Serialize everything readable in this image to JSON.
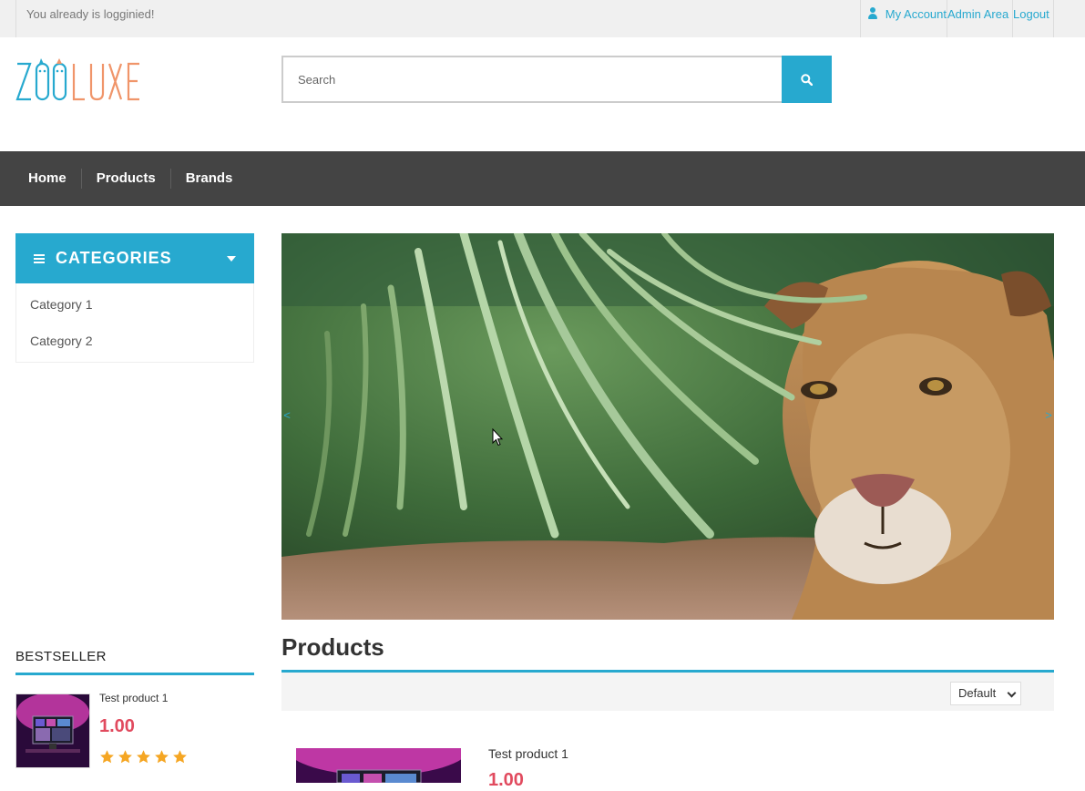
{
  "topbar": {
    "login_message": "You already is logginied!",
    "links": {
      "my_account": "My Account",
      "admin_area": "Admin Area",
      "logout": "Logout"
    }
  },
  "logo": {
    "text": "ZOOLUXE",
    "part1": "ZOO",
    "part2": "LUXE"
  },
  "search": {
    "placeholder": "Search",
    "value": "",
    "icon": "search-icon"
  },
  "nav": {
    "items": [
      "Home",
      "Products",
      "Brands"
    ]
  },
  "categories": {
    "title": "CATEGORIES",
    "items": [
      "Category 1",
      "Category 2"
    ]
  },
  "slider": {
    "prev": "<",
    "next": ">",
    "image": "lioness in jungle"
  },
  "bestseller": {
    "title": "BESTSELLER",
    "product": {
      "name": "Test product 1",
      "price": "1.00",
      "rating": 5
    }
  },
  "products": {
    "title": "Products",
    "sort": {
      "selected": "Default"
    },
    "items": [
      {
        "name": "Test product 1",
        "price": "1.00"
      }
    ]
  },
  "colors": {
    "accent": "#27a9cf",
    "price": "#e14a5e",
    "nav_bg": "#444444",
    "star": "#f5a623",
    "logo_blue": "#27a9cf",
    "logo_orange": "#f0956a"
  }
}
